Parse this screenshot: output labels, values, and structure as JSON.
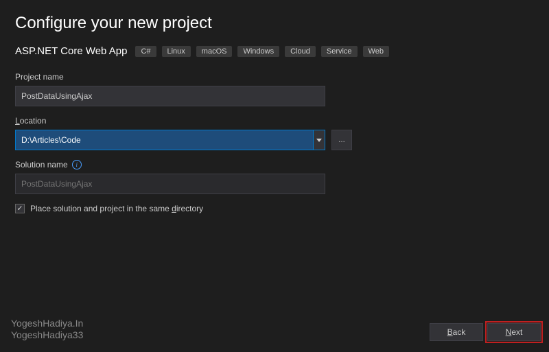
{
  "header": {
    "title": "Configure your new project",
    "subtitle": "ASP.NET Core Web App",
    "tags": [
      "C#",
      "Linux",
      "macOS",
      "Windows",
      "Cloud",
      "Service",
      "Web"
    ]
  },
  "fields": {
    "projectName": {
      "label": "Project name",
      "value": "PostDataUsingAjax"
    },
    "location": {
      "label": "Location",
      "accelChar": "L",
      "accelRest": "ocation",
      "value": "D:\\Articles\\Code"
    },
    "solutionName": {
      "label": "Solution name",
      "placeholder": "PostDataUsingAjax"
    },
    "sameDirCheckbox": {
      "label": "Place solution and project in the same ",
      "accelChar": "d",
      "accelRest": "irectory",
      "checked": true
    }
  },
  "buttons": {
    "back": {
      "accel": "B",
      "rest": "ack"
    },
    "next": {
      "accel": "N",
      "rest": "ext"
    }
  },
  "watermark": {
    "line1": "YogeshHadiya.In",
    "line2": "YogeshHadiya33"
  }
}
